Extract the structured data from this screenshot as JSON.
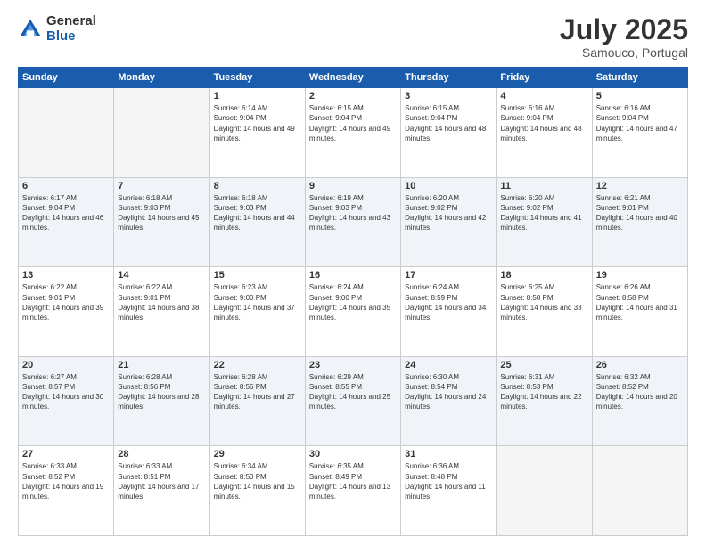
{
  "header": {
    "logo": {
      "general": "General",
      "blue": "Blue"
    },
    "title": "July 2025",
    "location": "Samouco, Portugal"
  },
  "weekdays": [
    "Sunday",
    "Monday",
    "Tuesday",
    "Wednesday",
    "Thursday",
    "Friday",
    "Saturday"
  ],
  "weeks": [
    [
      {
        "day": "",
        "sunrise": "",
        "sunset": "",
        "daylight": ""
      },
      {
        "day": "",
        "sunrise": "",
        "sunset": "",
        "daylight": ""
      },
      {
        "day": "1",
        "sunrise": "Sunrise: 6:14 AM",
        "sunset": "Sunset: 9:04 PM",
        "daylight": "Daylight: 14 hours and 49 minutes."
      },
      {
        "day": "2",
        "sunrise": "Sunrise: 6:15 AM",
        "sunset": "Sunset: 9:04 PM",
        "daylight": "Daylight: 14 hours and 49 minutes."
      },
      {
        "day": "3",
        "sunrise": "Sunrise: 6:15 AM",
        "sunset": "Sunset: 9:04 PM",
        "daylight": "Daylight: 14 hours and 48 minutes."
      },
      {
        "day": "4",
        "sunrise": "Sunrise: 6:16 AM",
        "sunset": "Sunset: 9:04 PM",
        "daylight": "Daylight: 14 hours and 48 minutes."
      },
      {
        "day": "5",
        "sunrise": "Sunrise: 6:16 AM",
        "sunset": "Sunset: 9:04 PM",
        "daylight": "Daylight: 14 hours and 47 minutes."
      }
    ],
    [
      {
        "day": "6",
        "sunrise": "Sunrise: 6:17 AM",
        "sunset": "Sunset: 9:04 PM",
        "daylight": "Daylight: 14 hours and 46 minutes."
      },
      {
        "day": "7",
        "sunrise": "Sunrise: 6:18 AM",
        "sunset": "Sunset: 9:03 PM",
        "daylight": "Daylight: 14 hours and 45 minutes."
      },
      {
        "day": "8",
        "sunrise": "Sunrise: 6:18 AM",
        "sunset": "Sunset: 9:03 PM",
        "daylight": "Daylight: 14 hours and 44 minutes."
      },
      {
        "day": "9",
        "sunrise": "Sunrise: 6:19 AM",
        "sunset": "Sunset: 9:03 PM",
        "daylight": "Daylight: 14 hours and 43 minutes."
      },
      {
        "day": "10",
        "sunrise": "Sunrise: 6:20 AM",
        "sunset": "Sunset: 9:02 PM",
        "daylight": "Daylight: 14 hours and 42 minutes."
      },
      {
        "day": "11",
        "sunrise": "Sunrise: 6:20 AM",
        "sunset": "Sunset: 9:02 PM",
        "daylight": "Daylight: 14 hours and 41 minutes."
      },
      {
        "day": "12",
        "sunrise": "Sunrise: 6:21 AM",
        "sunset": "Sunset: 9:01 PM",
        "daylight": "Daylight: 14 hours and 40 minutes."
      }
    ],
    [
      {
        "day": "13",
        "sunrise": "Sunrise: 6:22 AM",
        "sunset": "Sunset: 9:01 PM",
        "daylight": "Daylight: 14 hours and 39 minutes."
      },
      {
        "day": "14",
        "sunrise": "Sunrise: 6:22 AM",
        "sunset": "Sunset: 9:01 PM",
        "daylight": "Daylight: 14 hours and 38 minutes."
      },
      {
        "day": "15",
        "sunrise": "Sunrise: 6:23 AM",
        "sunset": "Sunset: 9:00 PM",
        "daylight": "Daylight: 14 hours and 37 minutes."
      },
      {
        "day": "16",
        "sunrise": "Sunrise: 6:24 AM",
        "sunset": "Sunset: 9:00 PM",
        "daylight": "Daylight: 14 hours and 35 minutes."
      },
      {
        "day": "17",
        "sunrise": "Sunrise: 6:24 AM",
        "sunset": "Sunset: 8:59 PM",
        "daylight": "Daylight: 14 hours and 34 minutes."
      },
      {
        "day": "18",
        "sunrise": "Sunrise: 6:25 AM",
        "sunset": "Sunset: 8:58 PM",
        "daylight": "Daylight: 14 hours and 33 minutes."
      },
      {
        "day": "19",
        "sunrise": "Sunrise: 6:26 AM",
        "sunset": "Sunset: 8:58 PM",
        "daylight": "Daylight: 14 hours and 31 minutes."
      }
    ],
    [
      {
        "day": "20",
        "sunrise": "Sunrise: 6:27 AM",
        "sunset": "Sunset: 8:57 PM",
        "daylight": "Daylight: 14 hours and 30 minutes."
      },
      {
        "day": "21",
        "sunrise": "Sunrise: 6:28 AM",
        "sunset": "Sunset: 8:56 PM",
        "daylight": "Daylight: 14 hours and 28 minutes."
      },
      {
        "day": "22",
        "sunrise": "Sunrise: 6:28 AM",
        "sunset": "Sunset: 8:56 PM",
        "daylight": "Daylight: 14 hours and 27 minutes."
      },
      {
        "day": "23",
        "sunrise": "Sunrise: 6:29 AM",
        "sunset": "Sunset: 8:55 PM",
        "daylight": "Daylight: 14 hours and 25 minutes."
      },
      {
        "day": "24",
        "sunrise": "Sunrise: 6:30 AM",
        "sunset": "Sunset: 8:54 PM",
        "daylight": "Daylight: 14 hours and 24 minutes."
      },
      {
        "day": "25",
        "sunrise": "Sunrise: 6:31 AM",
        "sunset": "Sunset: 8:53 PM",
        "daylight": "Daylight: 14 hours and 22 minutes."
      },
      {
        "day": "26",
        "sunrise": "Sunrise: 6:32 AM",
        "sunset": "Sunset: 8:52 PM",
        "daylight": "Daylight: 14 hours and 20 minutes."
      }
    ],
    [
      {
        "day": "27",
        "sunrise": "Sunrise: 6:33 AM",
        "sunset": "Sunset: 8:52 PM",
        "daylight": "Daylight: 14 hours and 19 minutes."
      },
      {
        "day": "28",
        "sunrise": "Sunrise: 6:33 AM",
        "sunset": "Sunset: 8:51 PM",
        "daylight": "Daylight: 14 hours and 17 minutes."
      },
      {
        "day": "29",
        "sunrise": "Sunrise: 6:34 AM",
        "sunset": "Sunset: 8:50 PM",
        "daylight": "Daylight: 14 hours and 15 minutes."
      },
      {
        "day": "30",
        "sunrise": "Sunrise: 6:35 AM",
        "sunset": "Sunset: 8:49 PM",
        "daylight": "Daylight: 14 hours and 13 minutes."
      },
      {
        "day": "31",
        "sunrise": "Sunrise: 6:36 AM",
        "sunset": "Sunset: 8:48 PM",
        "daylight": "Daylight: 14 hours and 11 minutes."
      },
      {
        "day": "",
        "sunrise": "",
        "sunset": "",
        "daylight": ""
      },
      {
        "day": "",
        "sunrise": "",
        "sunset": "",
        "daylight": ""
      }
    ]
  ]
}
